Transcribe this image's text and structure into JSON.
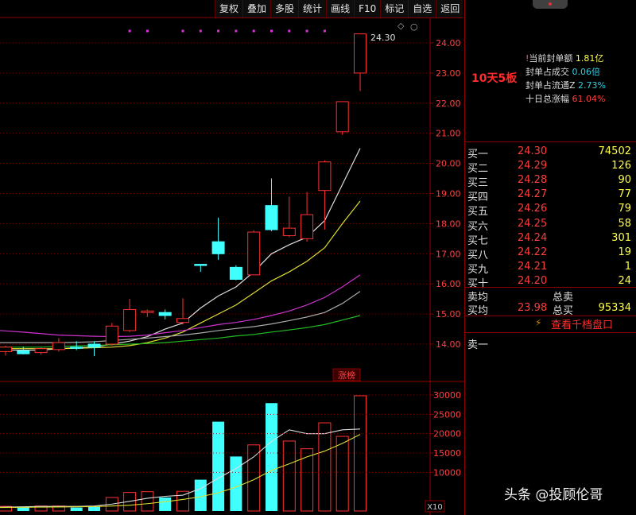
{
  "toolbar": {
    "items": [
      "复权",
      "叠加",
      "多股",
      "统计",
      "画线",
      "F10",
      "标记",
      "自选",
      "返回"
    ]
  },
  "kline": {
    "price_ticks": [
      "24.00",
      "23.00",
      "22.00",
      "21.00",
      "20.00",
      "19.00",
      "18.00",
      "17.00",
      "16.00",
      "15.00",
      "14.00"
    ],
    "max_price_label": "24.30",
    "limit_up_tag": "涨榜",
    "candles": [
      {
        "o": 13.75,
        "h": 13.95,
        "l": 13.62,
        "c": 13.9
      },
      {
        "o": 13.78,
        "h": 13.92,
        "l": 13.66,
        "c": 13.68
      },
      {
        "o": 13.72,
        "h": 13.9,
        "l": 13.65,
        "c": 13.85
      },
      {
        "o": 13.82,
        "h": 14.2,
        "l": 13.75,
        "c": 14.05
      },
      {
        "o": 13.9,
        "h": 14.1,
        "l": 13.8,
        "c": 13.88
      },
      {
        "o": 14.0,
        "h": 14.1,
        "l": 13.6,
        "c": 13.9
      },
      {
        "o": 14.0,
        "h": 14.7,
        "l": 13.95,
        "c": 14.6
      },
      {
        "o": 14.45,
        "h": 15.5,
        "l": 14.4,
        "c": 15.15
      },
      {
        "o": 15.05,
        "h": 15.15,
        "l": 14.9,
        "c": 15.1
      },
      {
        "o": 15.05,
        "h": 15.15,
        "l": 14.82,
        "c": 14.95
      },
      {
        "o": 14.72,
        "h": 15.52,
        "l": 14.65,
        "c": 14.85
      },
      {
        "o": 16.65,
        "h": 16.65,
        "l": 16.4,
        "c": 16.62
      },
      {
        "o": 17.4,
        "h": 18.2,
        "l": 16.8,
        "c": 17.0
      },
      {
        "o": 16.55,
        "h": 16.62,
        "l": 16.12,
        "c": 16.15
      },
      {
        "o": 16.3,
        "h": 17.78,
        "l": 16.3,
        "c": 17.72
      },
      {
        "o": 18.6,
        "h": 19.5,
        "l": 17.75,
        "c": 17.8
      },
      {
        "o": 17.6,
        "h": 18.9,
        "l": 17.55,
        "c": 17.85
      },
      {
        "o": 17.5,
        "h": 19.05,
        "l": 17.4,
        "c": 18.3
      },
      {
        "o": 19.1,
        "h": 20.1,
        "l": 17.8,
        "c": 20.05
      },
      {
        "o": 21.05,
        "h": 22.05,
        "l": 20.95,
        "c": 22.05
      },
      {
        "o": 23.0,
        "h": 24.3,
        "l": 22.4,
        "c": 24.3
      }
    ],
    "ma_lines": [
      {
        "color": "#dddddd",
        "values": [
          13.8,
          13.8,
          13.8,
          13.85,
          13.88,
          13.9,
          14.0,
          14.1,
          14.25,
          14.5,
          14.7,
          15.2,
          15.6,
          15.9,
          16.4,
          17.0,
          17.3,
          17.55,
          18.1,
          19.3,
          20.5
        ]
      },
      {
        "color": "#dddd33",
        "values": [
          13.85,
          13.85,
          13.85,
          13.85,
          13.86,
          13.88,
          13.9,
          13.95,
          14.05,
          14.2,
          14.4,
          14.7,
          15.0,
          15.3,
          15.7,
          16.1,
          16.4,
          16.75,
          17.2,
          18.0,
          18.75
        ]
      },
      {
        "color": "#cc33cc",
        "values": [
          14.45,
          14.4,
          14.35,
          14.3,
          14.28,
          14.26,
          14.25,
          14.26,
          14.3,
          14.38,
          14.45,
          14.55,
          14.65,
          14.72,
          14.82,
          14.95,
          15.1,
          15.3,
          15.55,
          15.9,
          16.3
        ]
      },
      {
        "color": "#aaaaaa",
        "values": [
          14.05,
          14.05,
          14.05,
          14.05,
          14.06,
          14.08,
          14.12,
          14.16,
          14.2,
          14.25,
          14.3,
          14.37,
          14.45,
          14.52,
          14.58,
          14.67,
          14.78,
          14.9,
          15.05,
          15.35,
          15.75
        ]
      },
      {
        "color": "#22bb22",
        "values": [
          13.9,
          13.9,
          13.9,
          13.92,
          13.94,
          13.95,
          13.98,
          14.0,
          14.02,
          14.05,
          14.1,
          14.15,
          14.2,
          14.27,
          14.32,
          14.4,
          14.47,
          14.55,
          14.65,
          14.8,
          14.95
        ]
      }
    ],
    "limit_up_marks": [
      7,
      8,
      10,
      11,
      12,
      13,
      14,
      15,
      16,
      17,
      18
    ]
  },
  "volume": {
    "ticks": [
      "30000",
      "25000",
      "20000",
      "15000",
      "10000"
    ],
    "unit_label": "X10",
    "values": [
      1200,
      1000,
      1300,
      1300,
      900,
      1100,
      3500,
      4800,
      5000,
      3500,
      5100,
      8100,
      23100,
      14100,
      17100,
      27900,
      18100,
      16100,
      22800,
      19300,
      29800
    ],
    "ma_lines": [
      {
        "color": "#dddddd",
        "values": [
          1000,
          1100,
          1200,
          1200,
          1200,
          1300,
          1800,
          2500,
          3300,
          3800,
          4100,
          5800,
          8500,
          11000,
          14000,
          18000,
          21000,
          20000,
          20000,
          21000,
          21200
        ]
      },
      {
        "color": "#dddd33",
        "values": [
          900,
          950,
          1000,
          1050,
          1100,
          1150,
          1300,
          1500,
          1900,
          2400,
          3000,
          3700,
          4700,
          6200,
          8100,
          10500,
          12200,
          14000,
          15500,
          17500,
          19800
        ]
      }
    ]
  },
  "info": {
    "banner": "10天5板",
    "stats": [
      {
        "key": "当前封单额",
        "value": "1.81亿",
        "color": "#ffff44"
      },
      {
        "key": "封单占成交",
        "value": "0.06倍",
        "color": "#33ccdd"
      },
      {
        "key": "封单占流通Z",
        "value": "2.73%",
        "color": "#33ccdd"
      },
      {
        "key": "十日总涨幅",
        "value": "61.04%",
        "color": "#ff3d3d"
      }
    ]
  },
  "order_book": {
    "bids": [
      {
        "label": "买一",
        "price": "24.30",
        "vol": "74502"
      },
      {
        "label": "买二",
        "price": "24.29",
        "vol": "126"
      },
      {
        "label": "买三",
        "price": "24.28",
        "vol": "90"
      },
      {
        "label": "买四",
        "price": "24.27",
        "vol": "77"
      },
      {
        "label": "买五",
        "price": "24.26",
        "vol": "79"
      },
      {
        "label": "买六",
        "price": "24.25",
        "vol": "58"
      },
      {
        "label": "买七",
        "price": "24.24",
        "vol": "301"
      },
      {
        "label": "买八",
        "price": "24.22",
        "vol": "19"
      },
      {
        "label": "买九",
        "price": "24.21",
        "vol": "1"
      },
      {
        "label": "买十",
        "price": "24.20",
        "vol": "24"
      }
    ],
    "sell_avg_label": "卖均",
    "total_sell_label": "总卖",
    "buy_avg_label": "买均",
    "buy_avg_price": "23.98",
    "total_buy_label": "总买",
    "total_buy_vol": "95334",
    "ten_gear_link": "查看千档盘口",
    "sell1_label": "卖一"
  },
  "watermark": "头条 @投顾伦哥",
  "colors": {
    "up": "#ff3030",
    "down": "#40ffff",
    "grid": "#8b0000"
  }
}
